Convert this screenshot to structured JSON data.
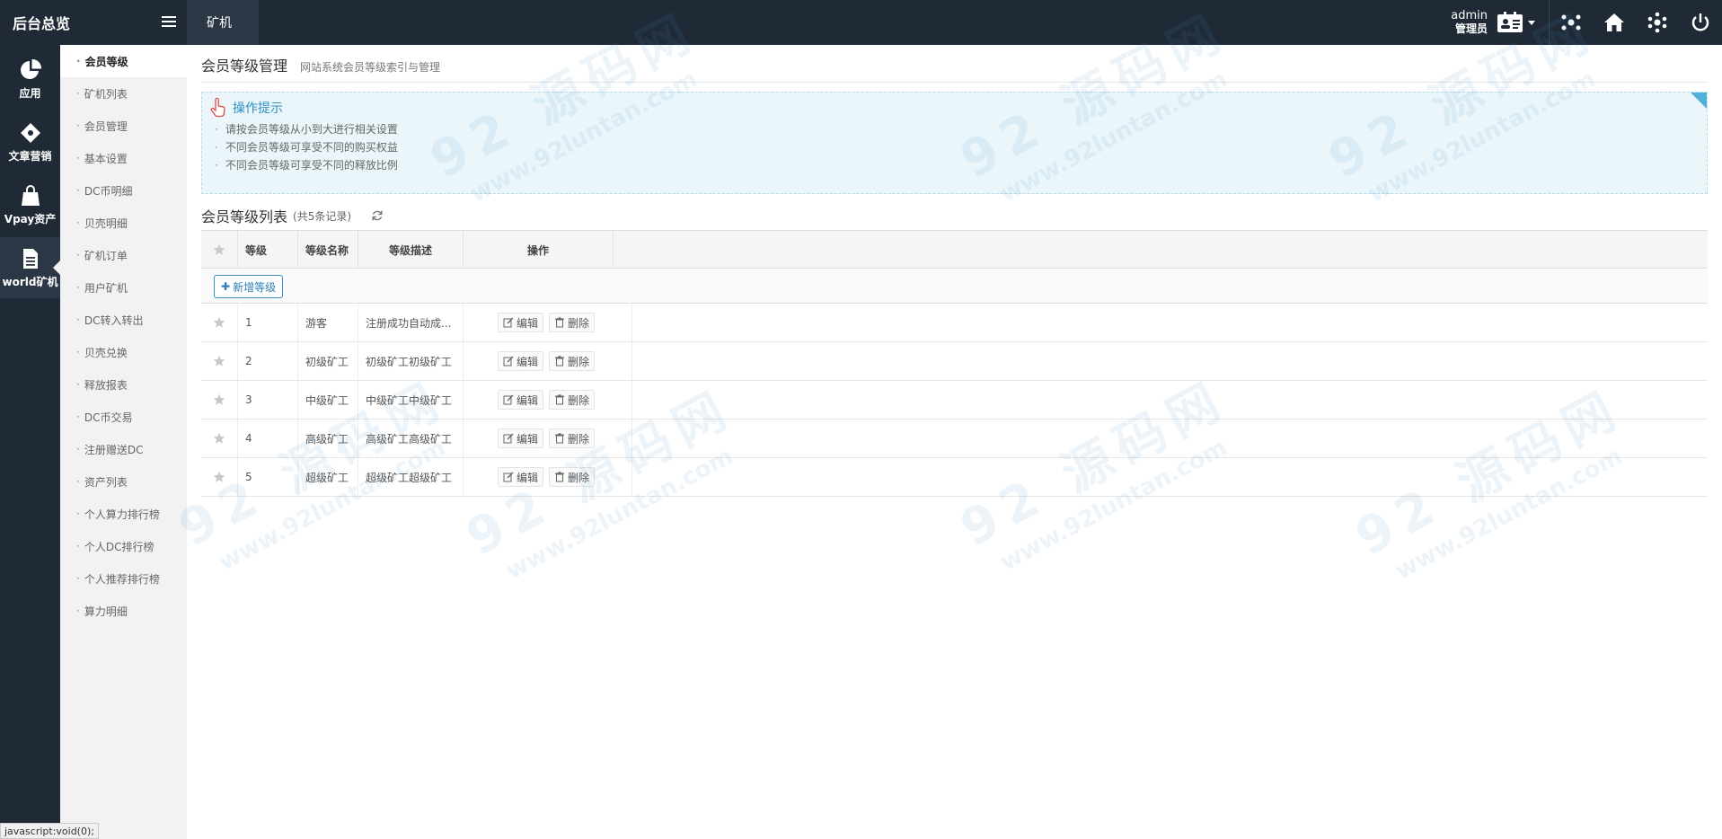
{
  "brand": {
    "title": "后台总览"
  },
  "top_tab": {
    "label": "矿机"
  },
  "user": {
    "name": "admin",
    "role": "管理员"
  },
  "iconbar": [
    {
      "label": "应用",
      "icon": "pie-chart-icon"
    },
    {
      "label": "文章营销",
      "icon": "puzzle-icon"
    },
    {
      "label": "Vpay资产",
      "icon": "bag-icon"
    },
    {
      "label": "world矿机",
      "icon": "document-icon"
    }
  ],
  "submenu": [
    "会员等级",
    "矿机列表",
    "会员管理",
    "基本设置",
    "DC币明细",
    "贝壳明细",
    "矿机订单",
    "用户矿机",
    "DC转入转出",
    "贝壳兑换",
    "释放报表",
    "DC币交易",
    "注册赠送DC",
    "资产列表",
    "个人算力排行榜",
    "个人DC排行榜",
    "个人推荐排行榜",
    "算力明细"
  ],
  "page": {
    "title": "会员等级管理",
    "subtitle": "网站系统会员等级索引与管理"
  },
  "tips": {
    "title": "操作提示",
    "lines": [
      "请按会员等级从小到大进行相关设置",
      "不同会员等级可享受不同的购买权益",
      "不同会员等级可享受不同的释放比例"
    ]
  },
  "list": {
    "title": "会员等级列表",
    "count": "(共5条记录)"
  },
  "table": {
    "headers": {
      "level": "等级",
      "name": "等级名称",
      "desc": "等级描述",
      "ops": "操作"
    },
    "add_label": "新增等级",
    "edit_label": "编辑",
    "delete_label": "删除",
    "rows": [
      {
        "level": "1",
        "name": "游客",
        "desc": "注册成功自动成..."
      },
      {
        "level": "2",
        "name": "初级矿工",
        "desc": "初级矿工初级矿工"
      },
      {
        "level": "3",
        "name": "中级矿工",
        "desc": "中级矿工中级矿工"
      },
      {
        "level": "4",
        "name": "高级矿工",
        "desc": "高级矿工高级矿工"
      },
      {
        "level": "5",
        "name": "超级矿工",
        "desc": "超级矿工超级矿工"
      }
    ]
  },
  "watermark": {
    "big": "92 源码网",
    "small": "www.92luntan.com"
  },
  "status_bar": {
    "text": "javascript:void(0);"
  },
  "colors": {
    "sidebar": "#1f2a36",
    "submenu": "#f2f2f2",
    "tips_bg": "#eaf6fa",
    "accent": "#2c8fbf"
  }
}
